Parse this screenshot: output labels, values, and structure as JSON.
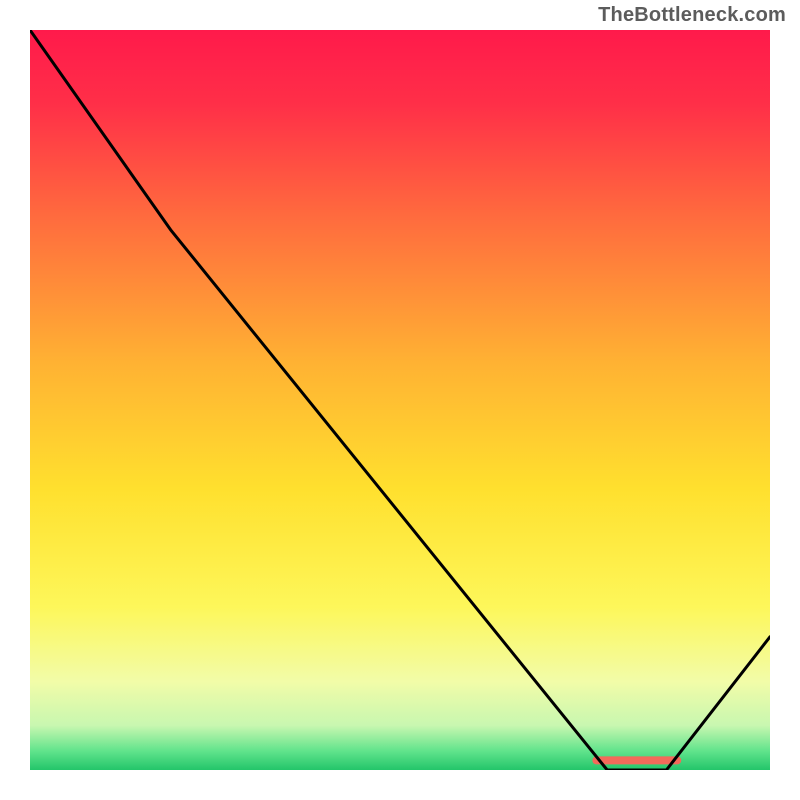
{
  "attribution": "TheBottleneck.com",
  "chart_data": {
    "type": "line",
    "title": "",
    "xlabel": "",
    "ylabel": "",
    "xlim": [
      0,
      100
    ],
    "ylim": [
      0,
      100
    ],
    "series": [
      {
        "name": "curve",
        "color": "#000000",
        "points": [
          {
            "x": 0,
            "y": 100
          },
          {
            "x": 19,
            "y": 73
          },
          {
            "x": 78,
            "y": 0
          },
          {
            "x": 86,
            "y": 0
          },
          {
            "x": 100,
            "y": 18
          }
        ]
      }
    ],
    "marker_band": {
      "x0": 76,
      "x1": 88,
      "y": 1.3,
      "color": "#f26a5a"
    },
    "gradient_stops": [
      {
        "offset": 0.0,
        "color": "#ff1a4b"
      },
      {
        "offset": 0.1,
        "color": "#ff2f48"
      },
      {
        "offset": 0.25,
        "color": "#ff6a3e"
      },
      {
        "offset": 0.45,
        "color": "#ffb233"
      },
      {
        "offset": 0.62,
        "color": "#ffe02e"
      },
      {
        "offset": 0.78,
        "color": "#fdf75a"
      },
      {
        "offset": 0.88,
        "color": "#f2fca8"
      },
      {
        "offset": 0.94,
        "color": "#c8f7b0"
      },
      {
        "offset": 0.975,
        "color": "#5fe38b"
      },
      {
        "offset": 1.0,
        "color": "#23c56a"
      }
    ]
  }
}
